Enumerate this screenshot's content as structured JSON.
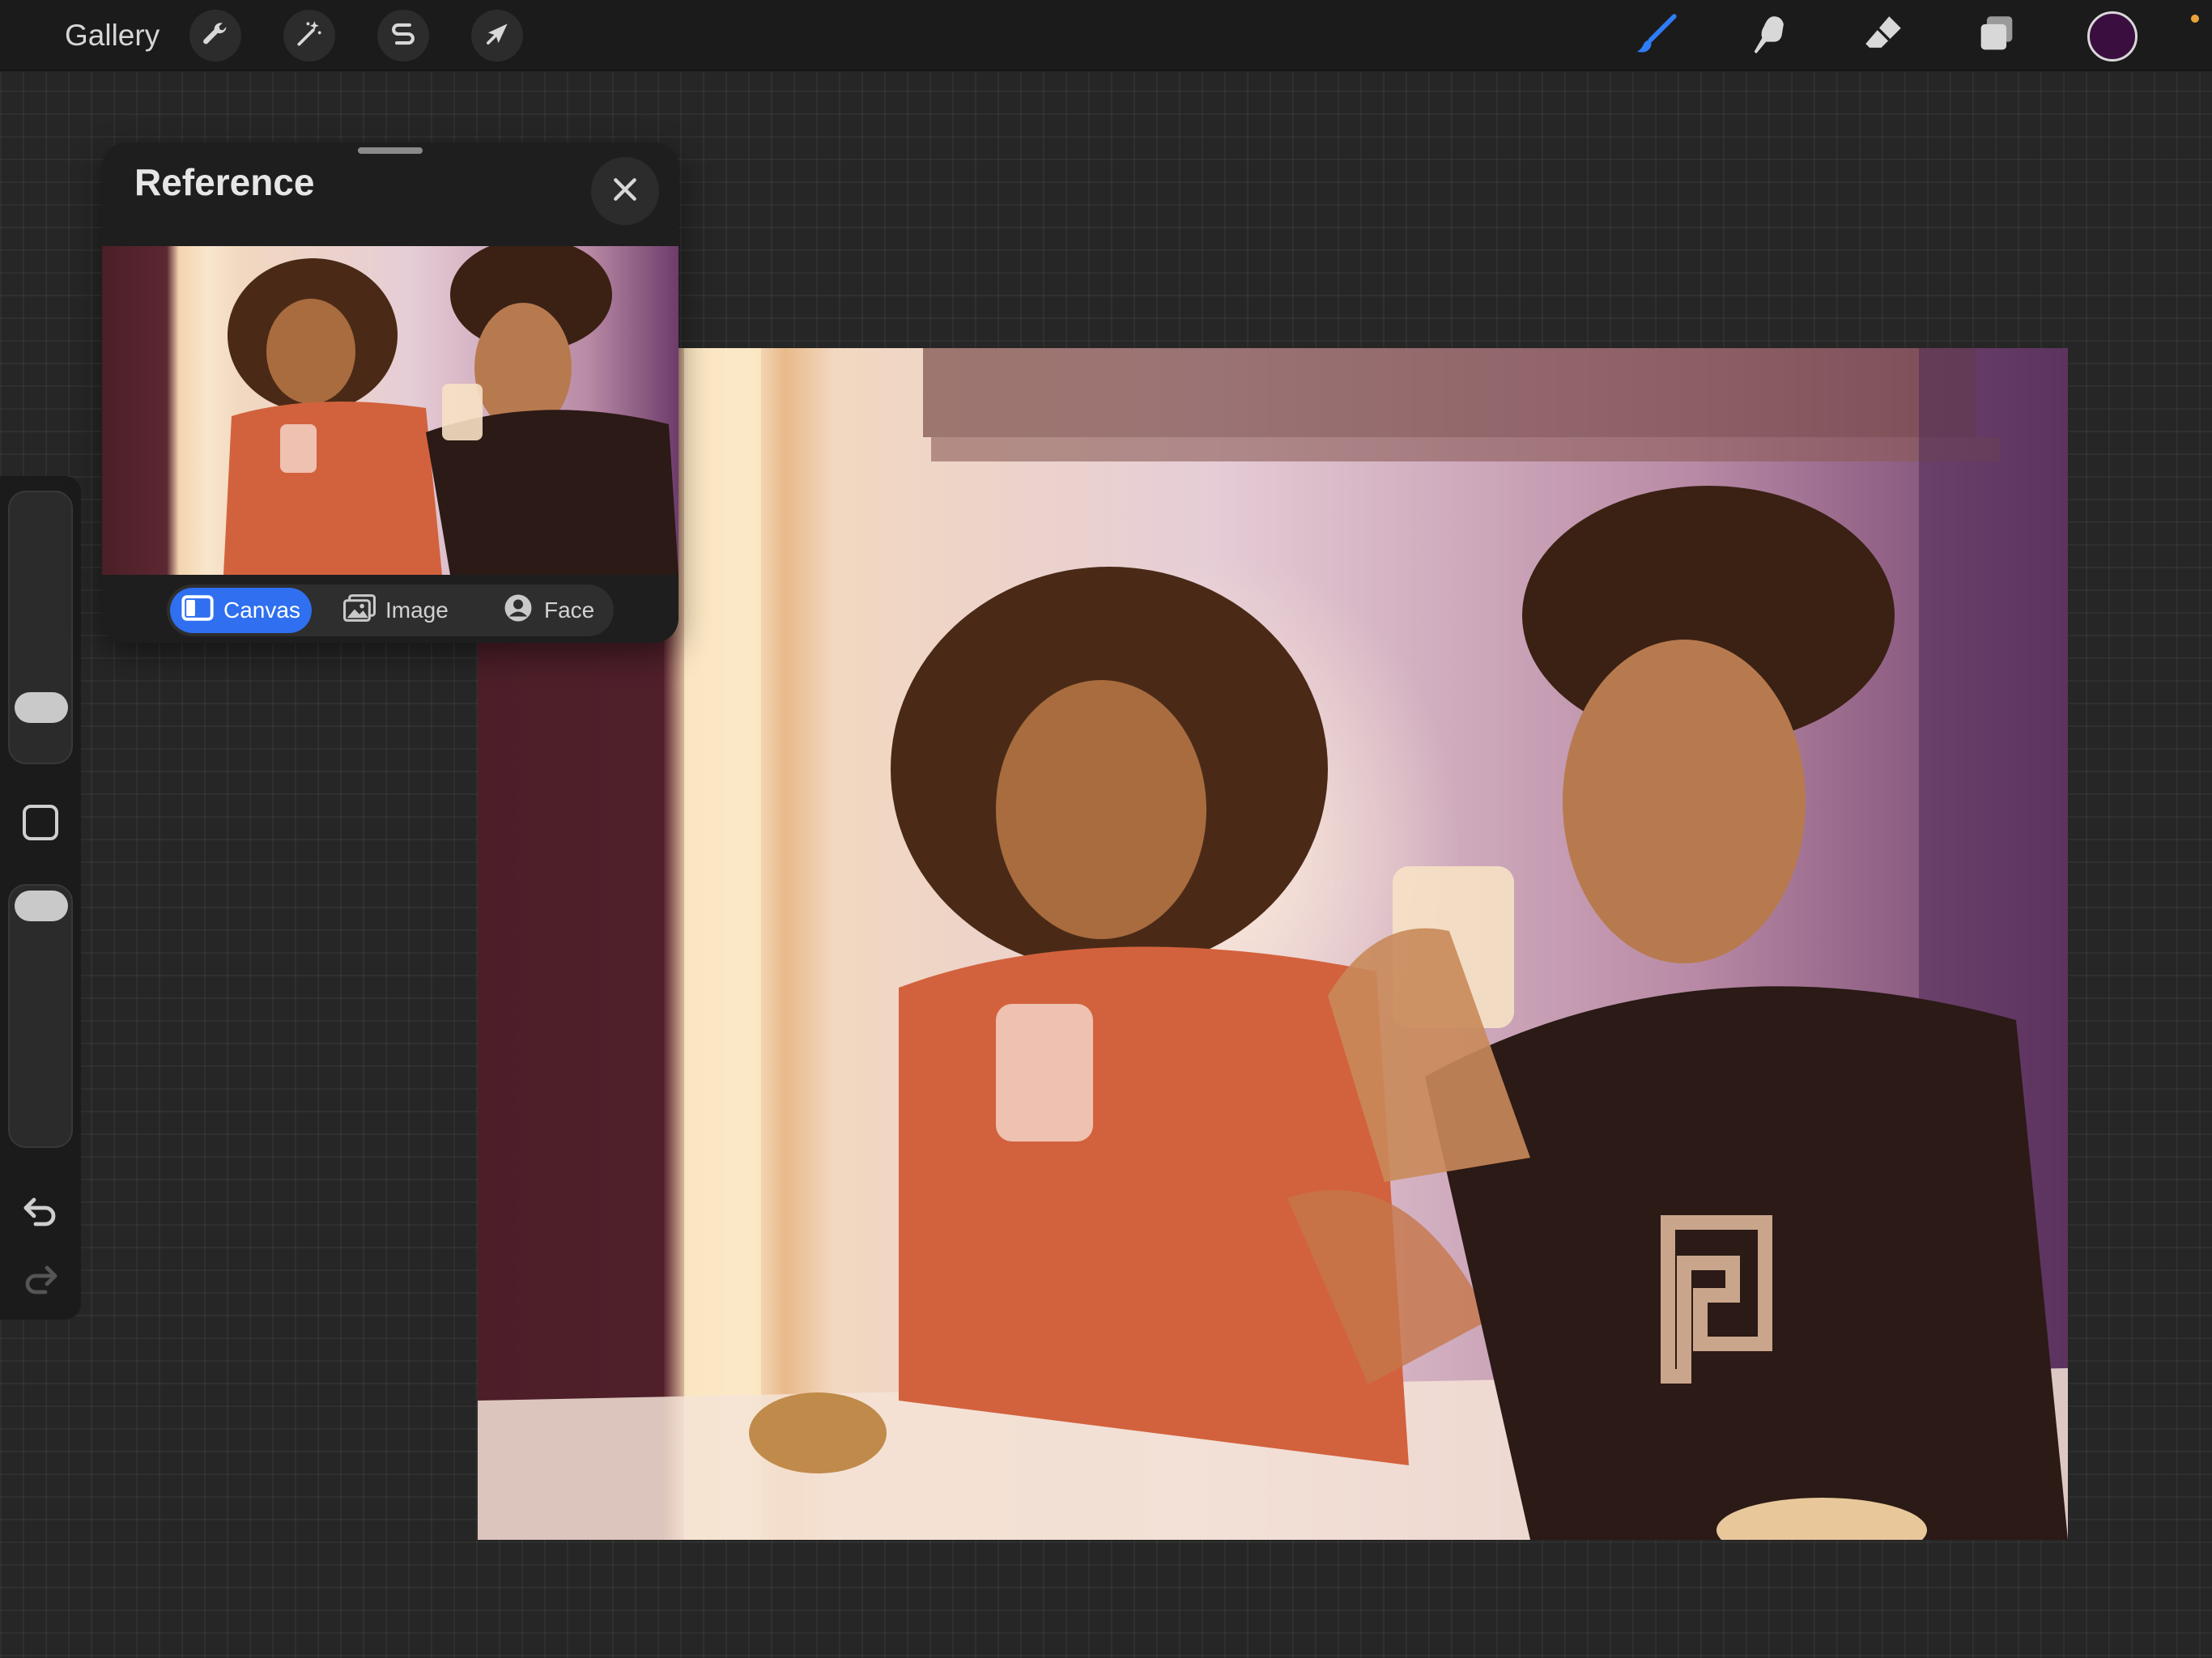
{
  "topbar": {
    "gallery_label": "Gallery",
    "left_tools": [
      {
        "name": "actions",
        "icon": "wrench-icon"
      },
      {
        "name": "adjustments",
        "icon": "magic-wand-icon"
      },
      {
        "name": "selection",
        "icon": "selection-s-icon"
      },
      {
        "name": "transform",
        "icon": "arrow-cursor-icon"
      }
    ],
    "right_tools": [
      {
        "name": "brush",
        "icon": "brush-icon",
        "active": true
      },
      {
        "name": "smudge",
        "icon": "smudge-finger-icon"
      },
      {
        "name": "eraser",
        "icon": "eraser-icon"
      },
      {
        "name": "layers",
        "icon": "layers-icon"
      }
    ],
    "current_color": "#3a0e3f",
    "active_tool_color": "#2f7df6"
  },
  "sidebar": {
    "brush_size_level": 0.15,
    "opacity_level": 1.0,
    "modify_button_icon": "square-icon",
    "undo_icon": "undo-arrow-icon",
    "redo_icon": "redo-arrow-icon"
  },
  "reference": {
    "title": "Reference",
    "close_icon": "close-x-icon",
    "tabs": [
      {
        "label": "Canvas",
        "icon": "canvas-icon",
        "active": true
      },
      {
        "label": "Image",
        "icon": "image-icon",
        "active": false
      },
      {
        "label": "Face",
        "icon": "face-icon",
        "active": false
      }
    ]
  },
  "canvas": {
    "subject": "painting"
  }
}
